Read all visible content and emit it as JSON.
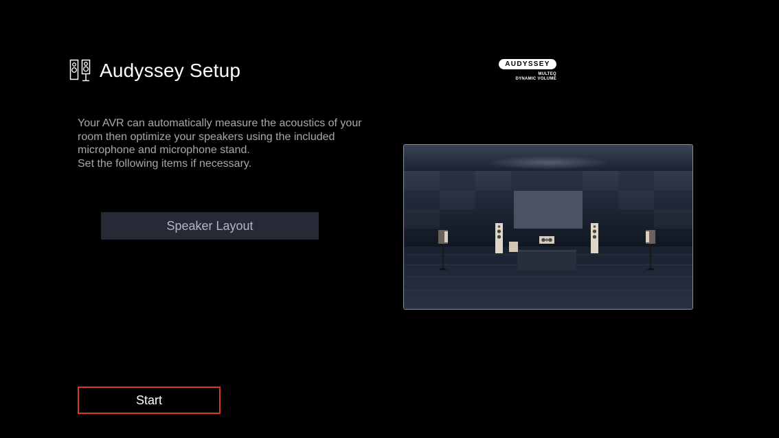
{
  "header": {
    "title": "Audyssey Setup",
    "icon": "speakers-icon"
  },
  "logo": {
    "brand": "AUDYSSEY",
    "line1": "MULTEQ",
    "line2": "DYNAMIC VOLUME"
  },
  "description": {
    "line1": "Your AVR can automatically measure the acoustics of your room then optimize your speakers using the included microphone and microphone stand.",
    "line2": "Set the following items if necessary."
  },
  "buttons": {
    "speaker_layout": "Speaker Layout",
    "start": "Start"
  },
  "colors": {
    "background": "#000000",
    "button_bg": "#262a36",
    "focus_border": "#d33a2c",
    "description_text": "#a9a9a9"
  }
}
